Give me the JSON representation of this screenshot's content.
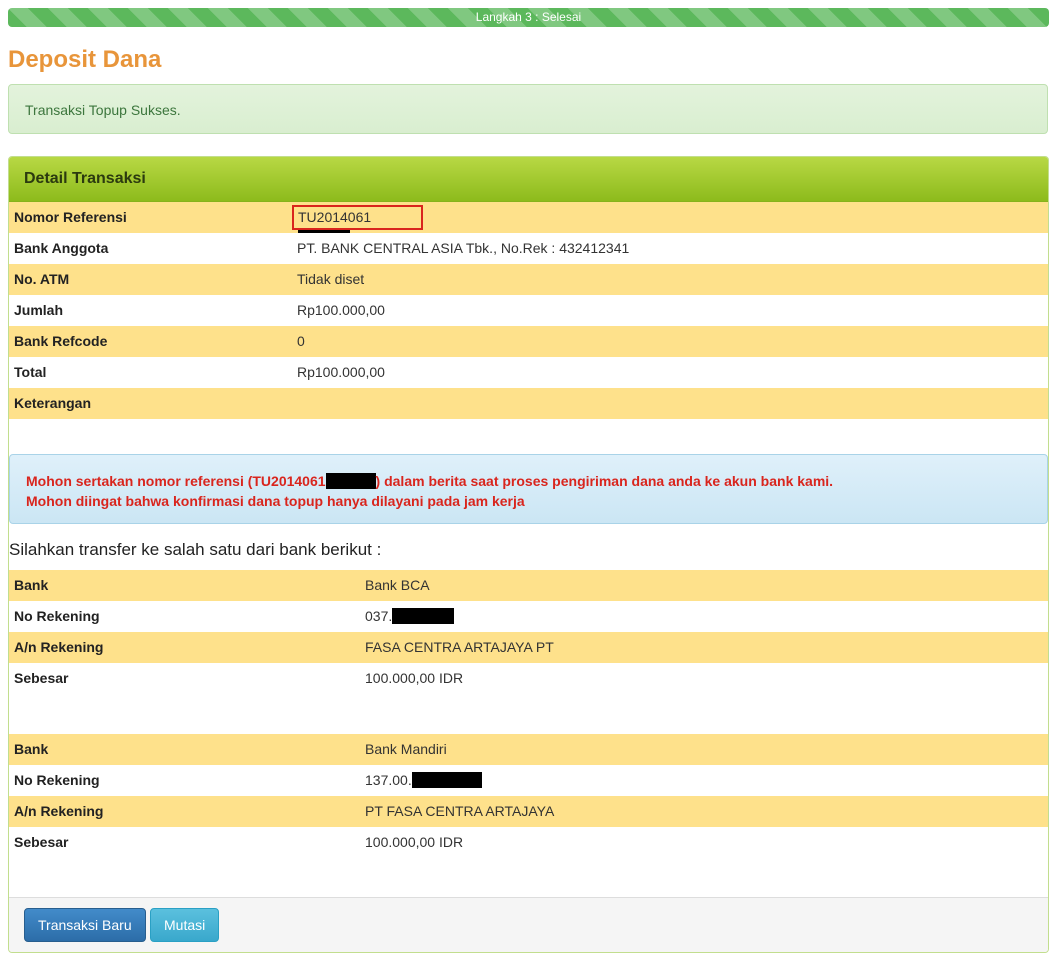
{
  "progress": {
    "label": "Langkah 3 : Selesai",
    "percent": 100
  },
  "page_title": "Deposit Dana",
  "alert_success": "Transaksi Topup Sukses.",
  "detail": {
    "heading": "Detail Transaksi",
    "rows": [
      {
        "label": "Nomor Referensi",
        "value": "TU2014061"
      },
      {
        "label": "Bank Anggota",
        "value": "PT. BANK CENTRAL ASIA Tbk., No.Rek : 432412341"
      },
      {
        "label": "No. ATM",
        "value": "Tidak diset"
      },
      {
        "label": "Jumlah",
        "value": "Rp100.000,00"
      },
      {
        "label": "Bank Refcode",
        "value": "0"
      },
      {
        "label": "Total",
        "value": "Rp100.000,00"
      },
      {
        "label": "Keterangan",
        "value": ""
      }
    ]
  },
  "notice": {
    "line1_before": "Mohon sertakan nomor referensi (TU2014061",
    "line1_after": ") dalam berita saat proses pengiriman dana anda ke akun bank kami.",
    "line2": "Mohon diingat bahwa konfirmasi dana topup hanya dilayani pada jam kerja"
  },
  "transfer_intro": "Silahkan transfer ke salah satu dari bank berikut :",
  "banks": [
    {
      "bank_label": "Bank",
      "bank": "Bank BCA",
      "account_label": "No Rekening",
      "account": "037.",
      "holder_label": "A/n Rekening",
      "holder": "FASA CENTRA ARTAJAYA PT",
      "amount_label": "Sebesar",
      "amount": "100.000,00 IDR"
    },
    {
      "bank_label": "Bank",
      "bank": "Bank Mandiri",
      "account_label": "No Rekening",
      "account": "137.00.",
      "holder_label": "A/n Rekening",
      "holder": "PT FASA CENTRA ARTAJAYA",
      "amount_label": "Sebesar",
      "amount": "100.000,00 IDR"
    }
  ],
  "buttons": {
    "new_transaction": "Transaksi Baru",
    "mutation": "Mutasi"
  },
  "colors": {
    "title": "#e8953a",
    "row_highlight": "#fee18b",
    "notice_text": "#d9251d",
    "heading_green": "#8dbb1c",
    "primary": "#428bca",
    "info": "#5bc0de"
  }
}
